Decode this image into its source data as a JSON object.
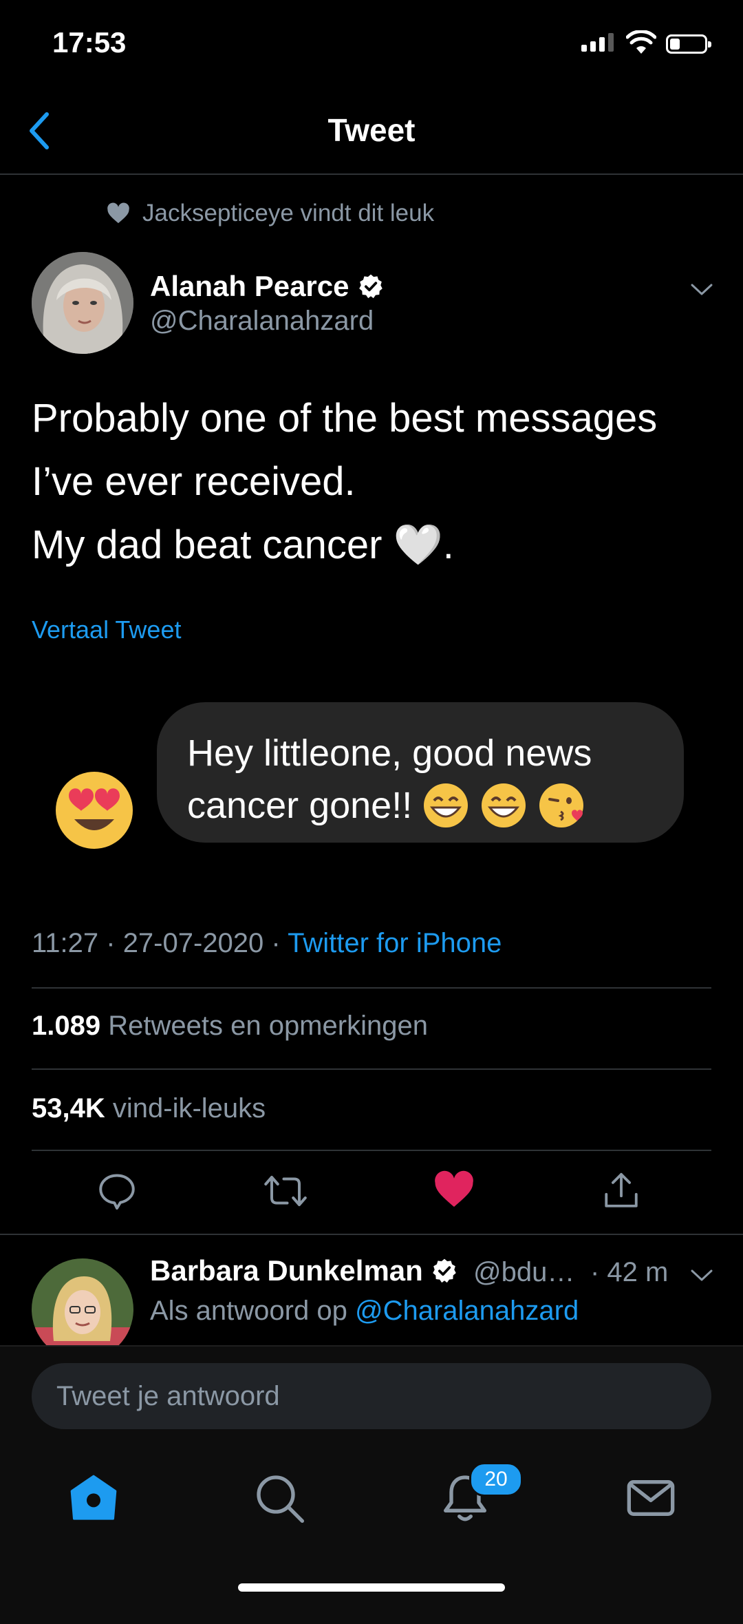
{
  "status_bar": {
    "time": "17:53"
  },
  "nav": {
    "title": "Tweet"
  },
  "social_context": {
    "text": "Jacksepticeye vindt dit leuk"
  },
  "tweet": {
    "author_name": "Alanah Pearce",
    "author_handle": "@Charalanahzard",
    "text_lines": [
      "Probably one of the best messages",
      "I’ve ever received.",
      "My dad beat cancer 🤍."
    ],
    "translate_label": "Vertaal Tweet",
    "message": {
      "line1": "Hey littleone, good news",
      "line2": "cancer gone!!"
    },
    "time": "11:27",
    "date": "27-07-2020",
    "source": "Twitter for iPhone",
    "retweets_count": "1.089",
    "retweets_label": "Retweets en opmerkingen",
    "likes_count": "53,4K",
    "likes_label": "vind-ik-leuks"
  },
  "reply": {
    "author_name": "Barbara Dunkelman",
    "author_handle": "@bdu…",
    "time": "· 42 m",
    "reply_to_label": "Als antwoord op",
    "reply_to_handle": "@Charalanahzard"
  },
  "composer": {
    "placeholder": "Tweet je antwoord"
  },
  "tab_bar": {
    "notifications_badge": "20"
  },
  "colors": {
    "accent": "#1d9bf0",
    "like": "#e0245e",
    "muted": "#8b98a5",
    "background": "#000000"
  },
  "icons": [
    "back-arrow-icon",
    "heart-icon",
    "verified-badge-icon",
    "chevron-down-icon",
    "reply-icon",
    "retweet-icon",
    "like-icon",
    "share-icon",
    "home-icon",
    "search-icon",
    "notifications-icon",
    "messages-icon"
  ]
}
